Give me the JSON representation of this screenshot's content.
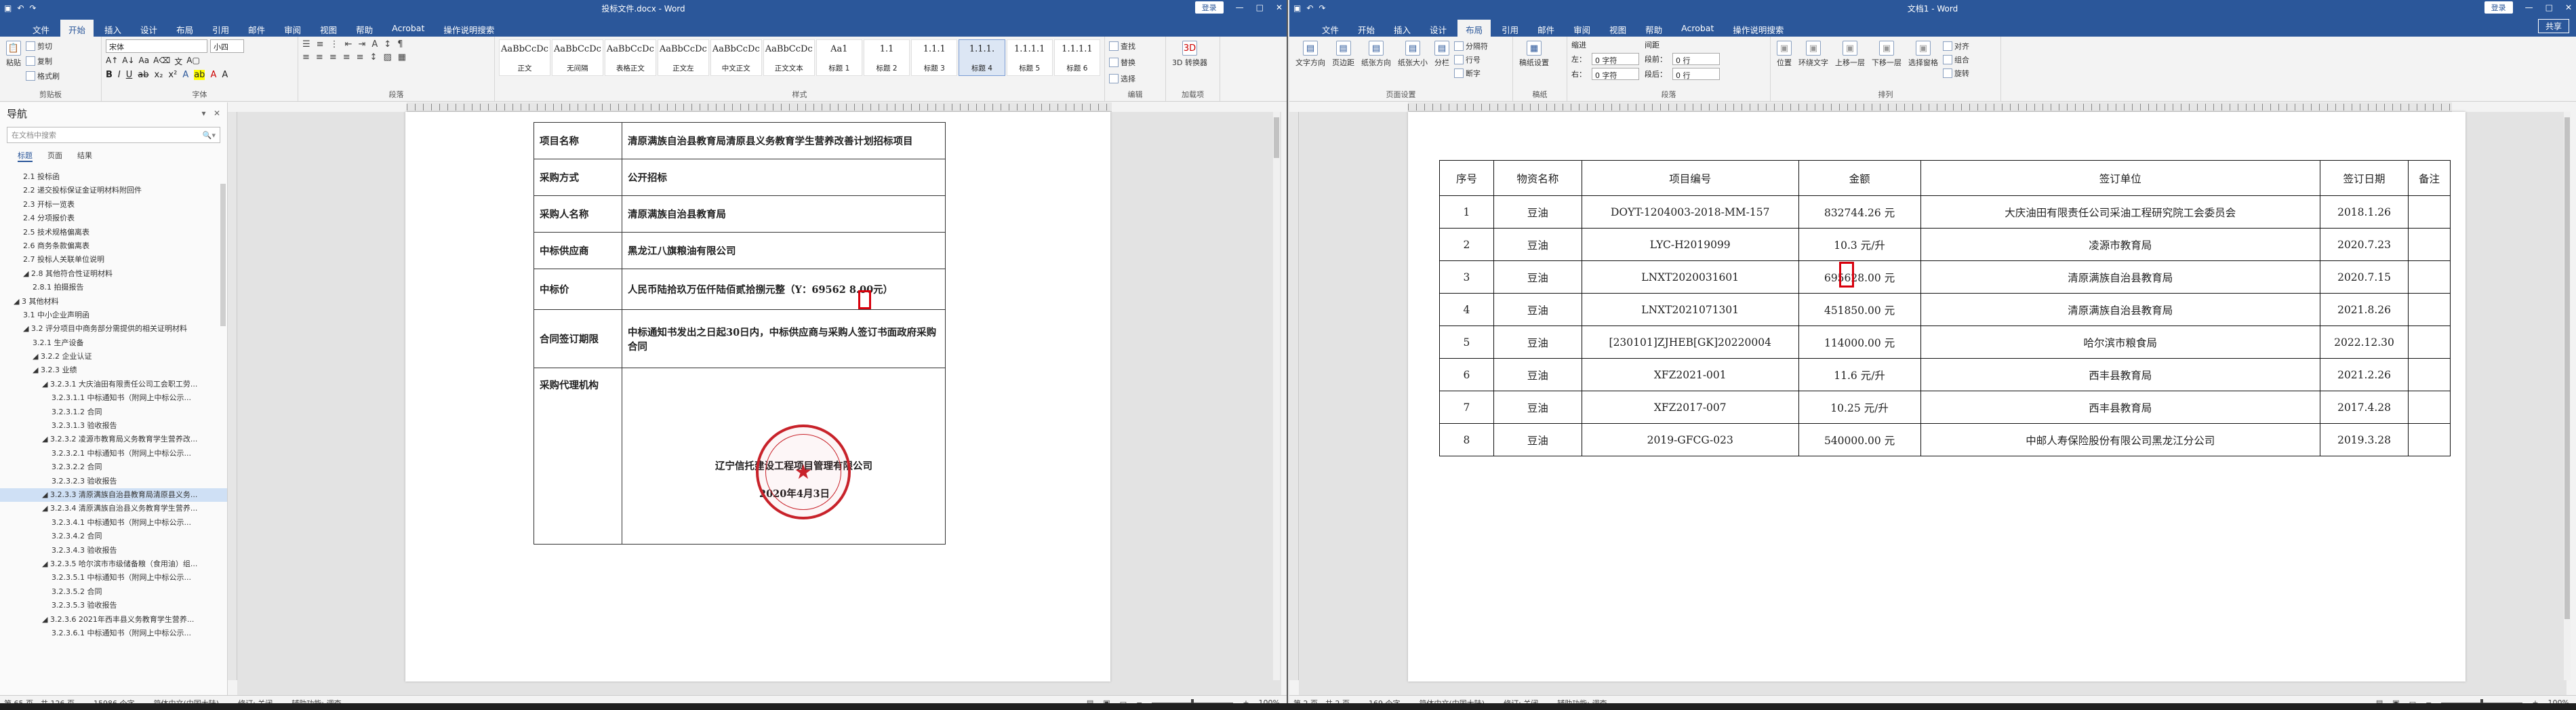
{
  "left": {
    "title": "投标文件.docx - Word",
    "signin": "登录",
    "menu": [
      "文件",
      "开始",
      "插入",
      "设计",
      "布局",
      "引用",
      "邮件",
      "审阅",
      "视图",
      "帮助",
      "Acrobat",
      "操作说明搜索"
    ],
    "ribbon": {
      "clipboard": {
        "label": "剪贴板",
        "paste": "粘贴",
        "cut": "剪切",
        "copy": "复制",
        "format_painter": "格式刷"
      },
      "font": {
        "label": "字体",
        "family": "宋体",
        "size": "小四"
      },
      "paragraph": {
        "label": "段落"
      },
      "styles": {
        "label": "样式",
        "items": [
          {
            "preview": "AaBbCcDc",
            "name": "正文"
          },
          {
            "preview": "AaBbCcDc",
            "name": "无间隔"
          },
          {
            "preview": "AaBbCcDc",
            "name": "表格正文"
          },
          {
            "preview": "AaBbCcDc",
            "name": "正文左"
          },
          {
            "preview": "AaBbCcDc",
            "name": "中文正文"
          },
          {
            "preview": "AaBbCcDc",
            "name": "正文文本"
          },
          {
            "preview": "Aa1",
            "name": "标题 1"
          },
          {
            "preview": "1.1",
            "name": "标题 2"
          },
          {
            "preview": "1.1.1",
            "name": "标题 3"
          },
          {
            "preview": "1.1.1.",
            "name": "标题 4"
          },
          {
            "preview": "1.1.1.1",
            "name": "标题 5"
          },
          {
            "preview": "1.1.1.1",
            "name": "标题 6"
          }
        ]
      },
      "editing": {
        "label": "编辑",
        "find": "查找",
        "replace": "替换",
        "select": "选择"
      },
      "addin": {
        "label": "加载项",
        "item": "3D 转换器"
      }
    },
    "nav": {
      "title": "导航",
      "search_placeholder": "在文档中搜索",
      "tabs": [
        "标题",
        "页面",
        "结果"
      ],
      "items": [
        {
          "t": "2.1 投标函",
          "hl": false
        },
        {
          "t": "2.2 递交投标保证金证明材料附回件",
          "hl": false
        },
        {
          "t": "2.3 开标一览表",
          "hl": false
        },
        {
          "t": "2.4 分项报价表",
          "hl": false
        },
        {
          "t": "2.5 技术规格偏离表",
          "hl": false
        },
        {
          "t": "2.6 商务条款偏离表",
          "hl": false
        },
        {
          "t": "2.7 投标人关联单位说明",
          "hl": false
        },
        {
          "t": "◢ 2.8 其他符合性证明材料",
          "hl": false
        },
        {
          "t": "2.8.1 拍摄报告",
          "hl": false
        },
        {
          "t": "◢ 3 其他材料",
          "hl": false
        },
        {
          "t": "3.1 中小企业声明函",
          "hl": false
        },
        {
          "t": "◢ 3.2 评分项目中商务部分需提供的相关证明材料",
          "hl": false
        },
        {
          "t": "3.2.1 生产设备",
          "hl": false
        },
        {
          "t": "◢ 3.2.2 企业认证",
          "hl": false
        },
        {
          "t": "◢ 3.2.3 业绩",
          "hl": false
        },
        {
          "t": "◢ 3.2.3.1 大庆油田有限责任公司工会职工劳...",
          "hl": false
        },
        {
          "t": "3.2.3.1.1 中标通知书（附网上中标公示...",
          "hl": false
        },
        {
          "t": "3.2.3.1.2 合同",
          "hl": false
        },
        {
          "t": "3.2.3.1.3 验收报告",
          "hl": false
        },
        {
          "t": "◢ 3.2.3.2 凌源市教育局义务教育学生营养改...",
          "hl": false
        },
        {
          "t": "3.2.3.2.1 中标通知书（附网上中标公示...",
          "hl": false
        },
        {
          "t": "3.2.3.2.2 合同",
          "hl": false
        },
        {
          "t": "3.2.3.2.3 验收报告",
          "hl": false
        },
        {
          "t": "◢ 3.2.3.3 清原满族自治县教育局清原县义务...",
          "hl": true
        },
        {
          "t": "◢ 3.2.3.4 清原满族自治县义务教育学生营养...",
          "hl": false
        },
        {
          "t": "3.2.3.4.1 中标通知书（附网上中标公示...",
          "hl": false
        },
        {
          "t": "3.2.3.4.2 合同",
          "hl": false
        },
        {
          "t": "3.2.3.4.3 验收报告",
          "hl": false
        },
        {
          "t": "◢ 3.2.3.5 哈尔滨市市级储备粮（食用油）组...",
          "hl": false
        },
        {
          "t": "3.2.3.5.1 中标通知书（附网上中标公示...",
          "hl": false
        },
        {
          "t": "3.2.3.5.2 合同",
          "hl": false
        },
        {
          "t": "3.2.3.5.3 验收报告",
          "hl": false
        },
        {
          "t": "◢ 3.2.3.6 2021年西丰县义务教育学生营养...",
          "hl": false
        },
        {
          "t": "3.2.3.6.1 中标通知书（附网上中标公示...",
          "hl": false
        }
      ]
    },
    "doc": {
      "rows": [
        {
          "k": "项目名称",
          "v": "清原满族自治县教育局清原县义务教育学生营养改善计划招标项目"
        },
        {
          "k": "采购方式",
          "v": "公开招标"
        },
        {
          "k": "采购人名称",
          "v": "清原满族自治县教育局"
        },
        {
          "k": "中标供应商",
          "v": "黑龙江八旗粮油有限公司"
        },
        {
          "k": "中标价",
          "v": "人民币陆拾玖万伍仟陆佰贰拾捌元整（Y：69562 8.00元）"
        },
        {
          "k": "合同签订期限",
          "v": "中标通知书发出之日起30日内，中标供应商与采购人签订书面政府采购合同"
        },
        {
          "k": "采购代理机构",
          "v": ""
        }
      ],
      "agency": "辽宁信托建设工程项目管理有限公司",
      "date": "2020年4月3日",
      "stamp_text": "辽宁信托工程项目管理有限公司"
    },
    "status": {
      "page": "第 65 页，共 126 页",
      "words": "15986 个字",
      "lang": "简体中文(中国大陆)",
      "track": "修订: 关闭",
      "access": "辅助功能: 调查",
      "zoom": "100%"
    }
  },
  "right": {
    "title": "文档1 - Word",
    "signin": "登录",
    "share": "共享",
    "menu": [
      "文件",
      "开始",
      "插入",
      "设计",
      "布局",
      "引用",
      "邮件",
      "审阅",
      "视图",
      "帮助",
      "Acrobat",
      "操作说明搜索"
    ],
    "ribbon": {
      "page_setup": {
        "label": "页面设置",
        "buttons": [
          "文字方向",
          "页边距",
          "纸张方向",
          "纸张大小",
          "分栏"
        ],
        "small": [
          "分隔符",
          "行号",
          "断字"
        ]
      },
      "manuscript": {
        "label": "稿纸",
        "button": "稿纸设置"
      },
      "paragraph": {
        "label": "段落",
        "indent": "缩进",
        "spacing": "间距",
        "left": "左：",
        "right": "右：",
        "before": "段前：",
        "after": "段后：",
        "left_val": "0 字符",
        "right_val": "0 字符",
        "before_val": "0 行",
        "after_val": "0 行"
      },
      "arrange": {
        "label": "排列",
        "buttons": [
          "位置",
          "环绕文字",
          "上移一层",
          "下移一层",
          "选择窗格"
        ],
        "small": [
          "对齐",
          "组合",
          "旋转"
        ]
      }
    },
    "table": {
      "headers": [
        "序号",
        "物资名称",
        "项目编号",
        "金额",
        "签订单位",
        "签订日期",
        "备注"
      ],
      "rows": [
        [
          "1",
          "豆油",
          "DOYT-1204003-2018-MM-157",
          "832744.26 元",
          "大庆油田有限责任公司采油工程研究院工会委员会",
          "2018.1.26",
          ""
        ],
        [
          "2",
          "豆油",
          "LYC-H2019099",
          "10.3 元/升",
          "凌源市教育局",
          "2020.7.23",
          ""
        ],
        [
          "3",
          "豆油",
          "LNXT2020031601",
          "695628.00 元",
          "清原满族自治县教育局",
          "2020.7.15",
          ""
        ],
        [
          "4",
          "豆油",
          "LNXT2021071301",
          "451850.00 元",
          "清原满族自治县教育局",
          "2021.8.26",
          ""
        ],
        [
          "5",
          "豆油",
          "[230101]ZJHEB[GK]20220004",
          "114000.00 元",
          "哈尔滨市粮食局",
          "2022.12.30",
          ""
        ],
        [
          "6",
          "豆油",
          "XFZ2021-001",
          "11.6 元/升",
          "西丰县教育局",
          "2021.2.26",
          ""
        ],
        [
          "7",
          "豆油",
          "XFZ2017-007",
          "10.25 元/升",
          "西丰县教育局",
          "2017.4.28",
          ""
        ],
        [
          "8",
          "豆油",
          "2019-GFCG-023",
          "540000.00 元",
          "中邮人寿保险股份有限公司黑龙江分公司",
          "2019.3.28",
          ""
        ]
      ]
    },
    "status": {
      "page": "第 2 页，共 2 页",
      "words": "169 个字",
      "lang": "简体中文(中国大陆)",
      "track": "修订: 关闭",
      "access": "辅助功能: 调查",
      "zoom": "100%"
    }
  }
}
